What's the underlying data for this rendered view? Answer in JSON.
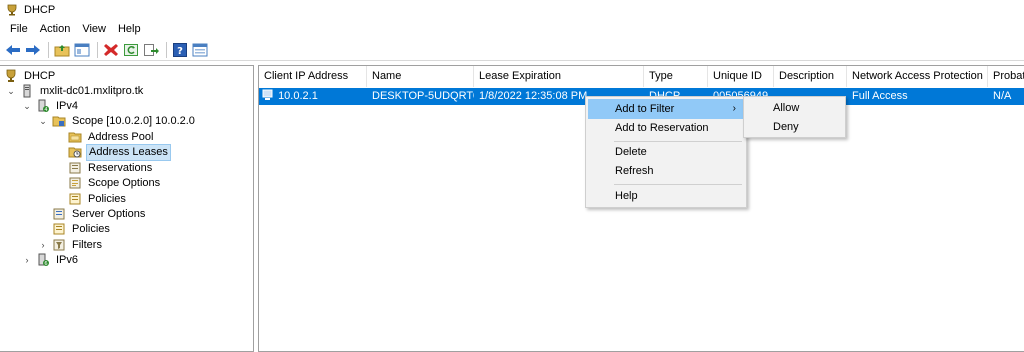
{
  "window": {
    "title": "DHCP"
  },
  "menu": [
    "File",
    "Action",
    "View",
    "Help"
  ],
  "toolbar": {
    "icons": [
      "back-icon",
      "forward-icon",
      "up-folder-icon",
      "show-hide-tree-icon",
      "delete-icon",
      "refresh-icon",
      "export-list-icon",
      "help-icon",
      "properties-icon"
    ]
  },
  "tree": {
    "items": [
      {
        "label": "DHCP",
        "icon": "dhcp-root-icon",
        "expanded": null
      },
      {
        "label": "mxlit-dc01.mxlitpro.tk",
        "icon": "server-icon",
        "expanded": true
      },
      {
        "label": "IPv4",
        "icon": "ipv4-icon",
        "expanded": true
      },
      {
        "label": "Scope [10.0.2.0] 10.0.2.0",
        "icon": "scope-folder-icon",
        "expanded": true
      },
      {
        "label": "Address Pool",
        "icon": "address-pool-icon",
        "expanded": null
      },
      {
        "label": "Address Leases",
        "icon": "address-leases-icon",
        "expanded": null,
        "selected": true
      },
      {
        "label": "Reservations",
        "icon": "reservations-icon",
        "expanded": null
      },
      {
        "label": "Scope Options",
        "icon": "scope-options-icon",
        "expanded": null
      },
      {
        "label": "Policies",
        "icon": "policies-icon",
        "expanded": null
      },
      {
        "label": "Server Options",
        "icon": "server-options-icon",
        "expanded": null
      },
      {
        "label": "Policies",
        "icon": "policies-icon",
        "expanded": null
      },
      {
        "label": "Filters",
        "icon": "filters-icon",
        "expanded": false
      },
      {
        "label": "IPv6",
        "icon": "ipv6-icon",
        "expanded": false
      }
    ]
  },
  "list": {
    "columns": [
      "Client IP Address",
      "Name",
      "Lease Expiration",
      "Type",
      "Unique ID",
      "Description",
      "Network Access Protection",
      "Probat"
    ],
    "rows": [
      {
        "ip": "10.0.2.1",
        "name": "DESKTOP-5UDQRT0...",
        "lease_expiration": "1/8/2022 12:35:08 PM",
        "type": "DHCP",
        "unique_id": "005056949",
        "description": "",
        "nap": "Full Access",
        "probation": "N/A",
        "selected": true
      }
    ]
  },
  "context_menu": {
    "items": {
      "add_to_filter": "Add to Filter",
      "add_to_reservation": "Add to Reservation",
      "delete": "Delete",
      "refresh": "Refresh",
      "help": "Help"
    },
    "submenu_arrow": "›",
    "submenu": {
      "allow": "Allow",
      "deny": "Deny"
    }
  },
  "colors": {
    "selection_blue": "#0078d7",
    "menu_highlight": "#91c9f7",
    "tree_selection": "#cce4f7"
  }
}
